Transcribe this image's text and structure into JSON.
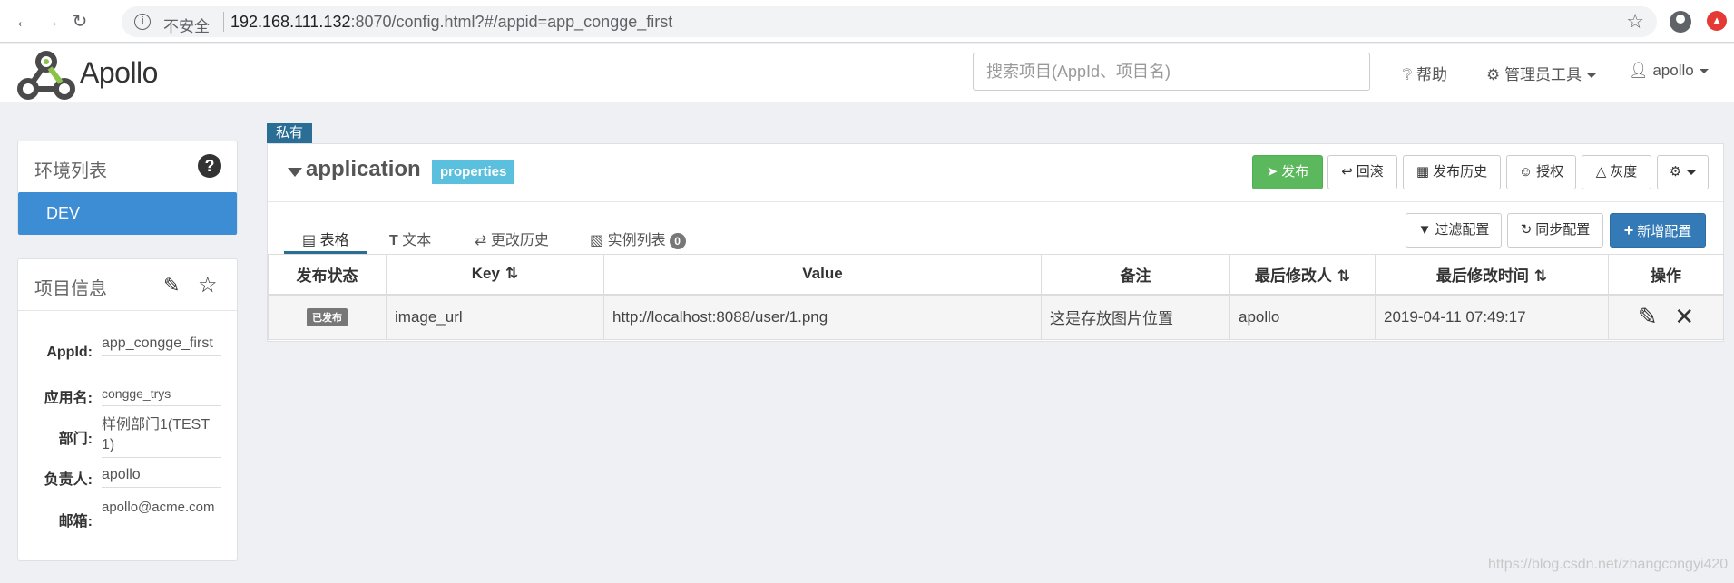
{
  "browser": {
    "insecure_label": "不安全",
    "url_host": "192.168.111.132",
    "url_rest": ":8070/config.html?#/appid=app_congge_first"
  },
  "header": {
    "brand": "Apollo",
    "search_placeholder": "搜索项目(AppId、项目名)",
    "help": "帮助",
    "admin_tools": "管理员工具",
    "user": "apollo"
  },
  "env_panel": {
    "title": "环境列表",
    "envs": [
      "DEV"
    ]
  },
  "project_panel": {
    "title": "项目信息",
    "rows": [
      {
        "label": "AppId:",
        "value": "app_congge_first"
      },
      {
        "label": "应用名:",
        "value": "congge_trys"
      },
      {
        "label": "部门:",
        "value": "样例部门1(TEST1)"
      },
      {
        "label": "负责人:",
        "value": "apollo"
      },
      {
        "label": "邮箱:",
        "value": "apollo@acme.com"
      }
    ]
  },
  "namespace": {
    "badge": "私有",
    "name": "application",
    "format": "properties",
    "actions": {
      "publish": "发布",
      "rollback": "回滚",
      "history": "发布历史",
      "grant": "授权",
      "gray": "灰度"
    },
    "tabs": {
      "table": "表格",
      "text": "文本",
      "change_history": "更改历史",
      "instances": "实例列表",
      "instances_count": "0"
    },
    "tools": {
      "filter": "过滤配置",
      "sync": "同步配置",
      "add": "新增配置"
    },
    "columns": {
      "status": "发布状态",
      "key": "Key",
      "value": "Value",
      "comment": "备注",
      "modifier": "最后修改人",
      "modified_time": "最后修改时间",
      "ops": "操作"
    },
    "rows": [
      {
        "status": "已发布",
        "key": "image_url",
        "value": "http://localhost:8088/user/1.png",
        "comment": "这是存放图片位置",
        "modifier": "apollo",
        "modified_time": "2019-04-11 07:49:17"
      }
    ]
  },
  "watermark": "https://blog.csdn.net/zhangcongyi420",
  "colors": {
    "primary": "#3c8dd4",
    "publish_green": "#5cb85c",
    "add_blue": "#337ab7",
    "private_badge": "#2a6e96",
    "format_badge": "#5bc0de"
  }
}
